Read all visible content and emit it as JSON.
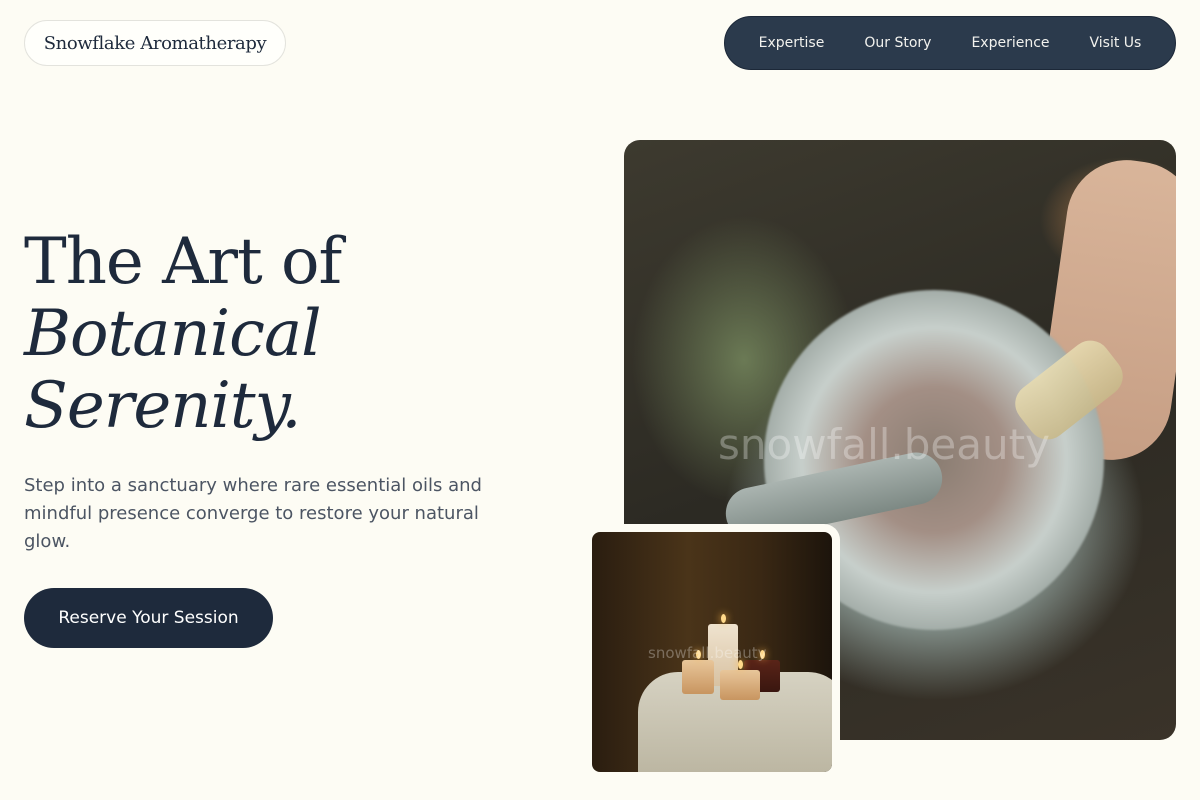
{
  "header": {
    "brand": "Snowflake Aromatherapy",
    "nav": [
      "Expertise",
      "Our Story",
      "Experience",
      "Visit Us"
    ]
  },
  "hero": {
    "headline_line1": "The Art of",
    "headline_line2": "Botanical",
    "headline_line3": "Serenity.",
    "lead": "Step into a sanctuary where rare essential oils and mindful presence converge to restore your natural glow.",
    "cta_label": "Reserve Your Session"
  },
  "images": {
    "main_watermark": "snowfall.beauty",
    "inset_watermark": "snowfall.beauty"
  },
  "colors": {
    "background": "#fdfcf4",
    "ink": "#1e2a3c",
    "nav_bg": "#2b3a4c"
  }
}
